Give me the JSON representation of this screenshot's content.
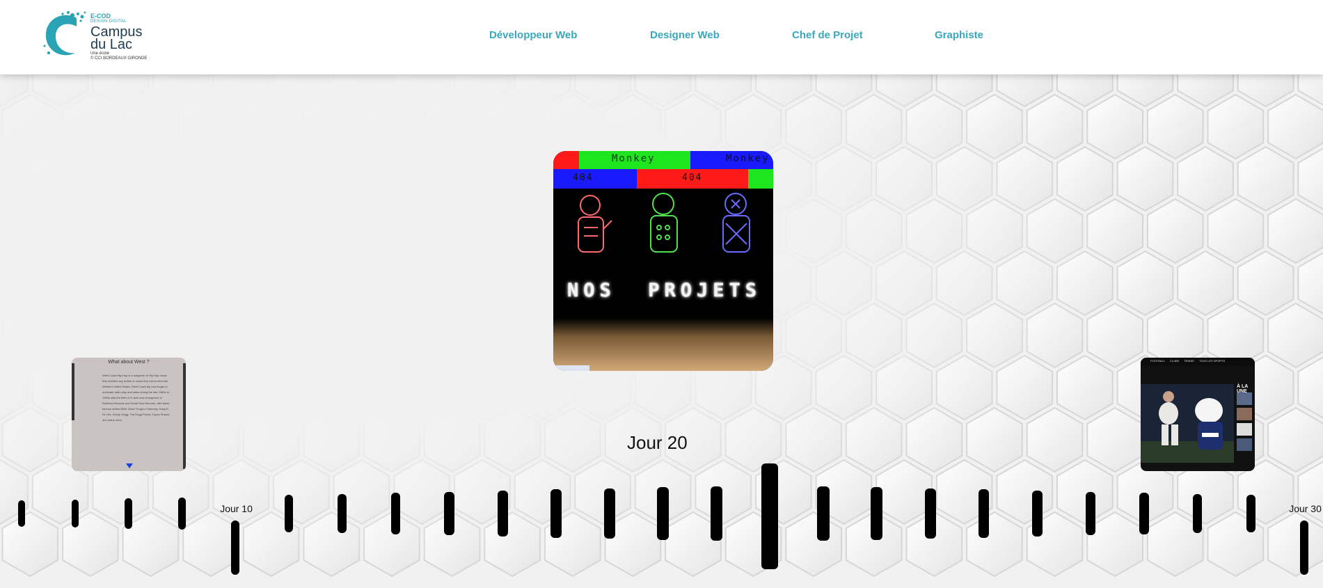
{
  "header": {
    "logo": {
      "ecod": "E-COD",
      "design": "DESIGN DIGITAL",
      "campus": "Campus",
      "lac": "du Lac",
      "une_ecole": "Une école",
      "cci": "© CCI BORDEAUX GIRONDE"
    },
    "nav": [
      {
        "label": "Développeur Web"
      },
      {
        "label": "Designer Web"
      },
      {
        "label": "Chef de Projet"
      },
      {
        "label": "Graphiste"
      }
    ]
  },
  "colors": {
    "accent": "#39a7bc",
    "logo_dark": "#1f3c50",
    "bg": "#f1f1f1",
    "tick": "#000000"
  },
  "cards": {
    "main": {
      "top_left_word": "Monkey",
      "top_right_word": "Monkey",
      "code_left": "404",
      "code_mid": "404",
      "heading": "NOS  PROJETS"
    },
    "left": {
      "title": "What about West ?",
      "body": "West Coast Hip-Hop is a subgenre of Hip Hop music that includes any artists or music that comes from the Western United States. West Coast hip hop began to dominate radio play and sales during the late 1980s to 1990s with the birth of G-funk and emergence of Ruthless Records and Death Row Records, with these famous artists NWA, Bone Thugs-n-Harmony, Eazy-E, Dr. Dre, Snoop Dogg, Tha Dogg Pound, Tupac Shakur, and many more."
    },
    "right": {
      "nav_items": [
        "FOOTBALL",
        "CLUBS",
        "TENNIS",
        "TOUS LES SPORTS"
      ],
      "headline": "À LA UNE"
    }
  },
  "timeline": {
    "current_label": "Jour 20",
    "labels": [
      {
        "day": 10,
        "text": "Jour 10"
      },
      {
        "day": 30,
        "text": "Jour 30"
      }
    ]
  }
}
